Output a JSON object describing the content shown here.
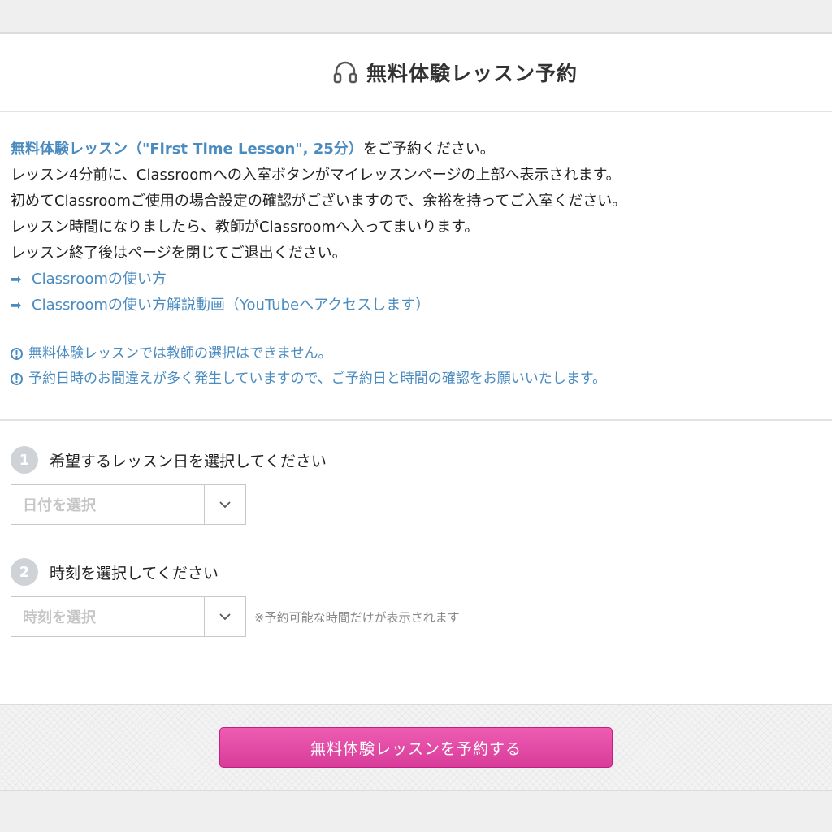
{
  "header": {
    "title": "無料体験レッスン予約",
    "icon": "headphones-icon"
  },
  "intro": {
    "lead_emphasis": "無料体験レッスン（\"First Time Lesson\", 25分）",
    "lead_rest": "をご予約ください。",
    "lines": [
      "レッスン4分前に、Classroomへの入室ボタンがマイレッスンページの上部へ表示されます。",
      "初めてClassroomご使用の場合設定の確認がございますので、余裕を持ってご入室ください。",
      "レッスン時間になりましたら、教師がClassroomへ入ってまいります。",
      "レッスン終了後はページを閉じてご退出ください。"
    ],
    "links": [
      "Classroomの使い方",
      "Classroomの使い方解説動画（YouTubeへアクセスします）"
    ],
    "notes": [
      "無料体験レッスンでは教師の選択はできません。",
      "予約日時のお間違えが多く発生していますので、ご予約日と時間の確認をお願いいたします。"
    ]
  },
  "form": {
    "step1": {
      "number": "1",
      "label": "希望するレッスン日を選択してください",
      "placeholder": "日付を選択"
    },
    "step2": {
      "number": "2",
      "label": "時刻を選択してください",
      "placeholder": "時刻を選択",
      "hint": "※予約可能な時間だけが表示されます"
    }
  },
  "submit_label": "無料体験レッスンを予約する",
  "colors": {
    "accent": "#4a8bc0",
    "button": "#e04aa6",
    "step_circle": "#cfd3d8"
  }
}
